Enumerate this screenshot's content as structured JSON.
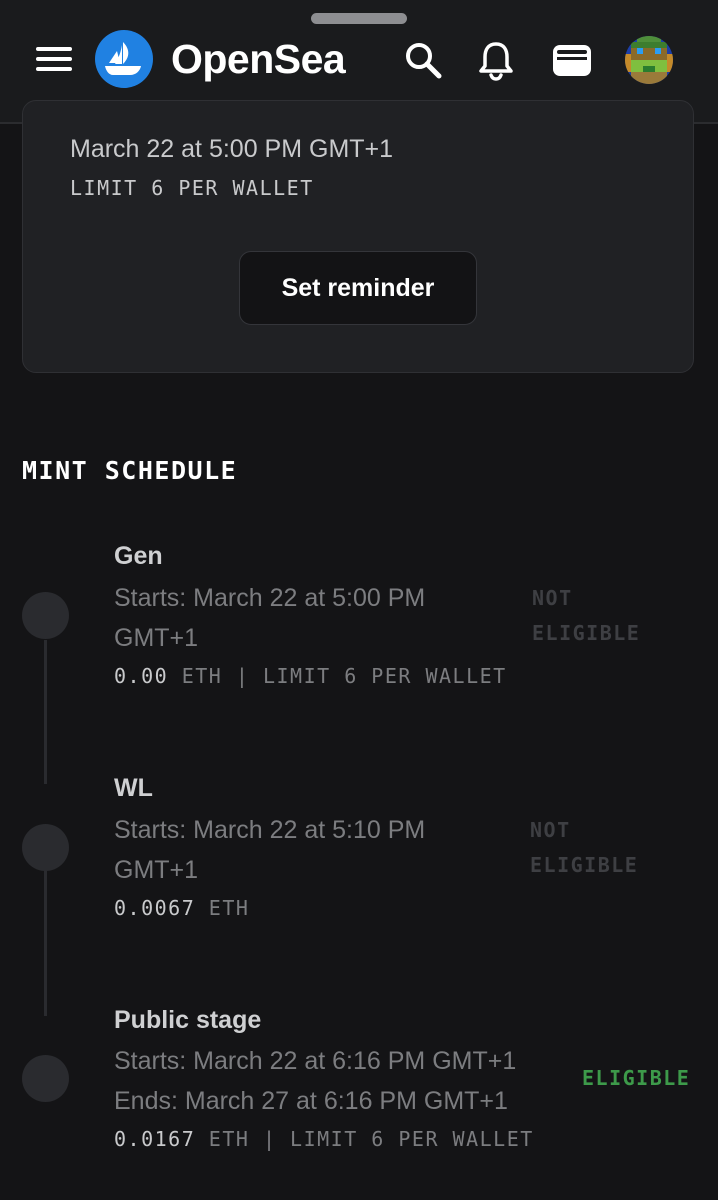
{
  "header": {
    "brand": "OpenSea",
    "icons": [
      "menu-icon",
      "opensea-logo-icon",
      "search-icon",
      "bell-icon",
      "wallet-icon",
      "avatar"
    ],
    "accent": "#2081e2"
  },
  "reminder_card": {
    "date": "March 22 at 5:00 PM GMT+1",
    "limit": "LIMIT 6 PER WALLET",
    "button_label": "Set reminder"
  },
  "mint_schedule": {
    "title": "MINT SCHEDULE",
    "stages": [
      {
        "name": "Gen",
        "starts_line1": "Starts: March 22 at 5:00 PM",
        "starts_line2": "GMT+1",
        "price": "0.00",
        "price_rest": " ETH | LIMIT 6 PER WALLET",
        "status_line1": "NOT",
        "status_line2": "ELIGIBLE"
      },
      {
        "name": "WL",
        "starts_line1": "Starts: March 22 at 5:10 PM",
        "starts_line2": "GMT+1",
        "price": "0.0067",
        "price_rest": " ETH",
        "status_line1": "NOT",
        "status_line2": "ELIGIBLE"
      },
      {
        "name": "Public stage",
        "starts_line1": "Starts: March 22 at 6:16 PM GMT+1",
        "starts_line2": "Ends: March 27 at 6:16 PM GMT+1",
        "price": "0.0167",
        "price_rest": " ETH | LIMIT 6 PER WALLET",
        "status_line1": "ELIGIBLE",
        "status_line2": ""
      }
    ]
  },
  "colors": {
    "background": "#141416",
    "eligible": "#3d9a4a",
    "not_eligible": "#3e3f43"
  }
}
